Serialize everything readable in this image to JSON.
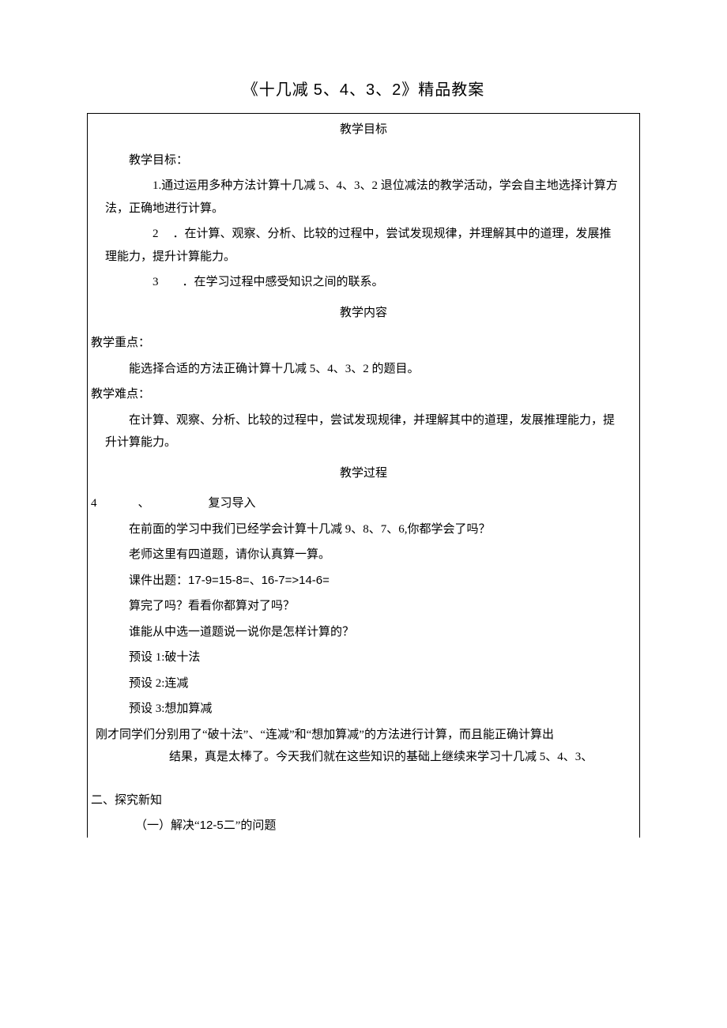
{
  "title_prefix": "《十几减 ",
  "title_digits": "5、4、3、2",
  "title_suffix": "》精品教案",
  "headings": {
    "goal": "教学目标",
    "content": "教学内容",
    "process": "教学过程"
  },
  "goal_label": "教学目标：",
  "goal_items": {
    "i1_num": "1.",
    "i1_text": "通过运用多种方法计算十几减 5、4、3、2 退位减法的教学活动，学会自主地选择计算方法，正确地进行计算。",
    "i2_num": "2",
    "i2_text": "．在计算、观察、分析、比较的过程中，尝试发现规律，并理解其中的道理，发展推理能力，提升计算能力。",
    "i3_num": "3",
    "i3_text": "．在学习过程中感受知识之间的联系。"
  },
  "focus_label": "教学重点：",
  "focus_text": "能选择合适的方法正确计算十几减 5、4、3、2 的题目。",
  "difficulty_label": "教学难点：",
  "difficulty_text": "在计算、观察、分析、比较的过程中，尝试发现规律，并理解其中的道理，发展推理能力，提升计算能力。",
  "review": {
    "num": "4",
    "sep": "、",
    "label": "复习导入",
    "p1": "在前面的学习中我们已经学会计算十几减 9、8、7、6,你都学会了吗？",
    "p2": "老师这里有四道题，请你认真算一算。",
    "p3_prefix": "课件出题：",
    "p3_eq": "17-9=15-8=、16-7=>14-6=",
    "p4": "算完了吗？看看你都算对了吗？",
    "p5": "谁能从中选一道题说一说你是怎样计算的？",
    "p6": "预设 1:破十法",
    "p7": "预设 2:连减",
    "p8": "预设 3:想加算减",
    "conc_line1": "刚才同学们分别用了“破十法”、“连减”和“想加算减”的方法进行计算，而且能正确计算出",
    "conc_line2": "结果，真是太棒了。今天我们就在这些知识的基础上继续来学习十几减 5、4、3、"
  },
  "explore": {
    "heading": "二、探究新知",
    "sub1_prefix": "（一）解决“",
    "sub1_eq": "12-5",
    "sub1_suffix": "二”的问题"
  }
}
